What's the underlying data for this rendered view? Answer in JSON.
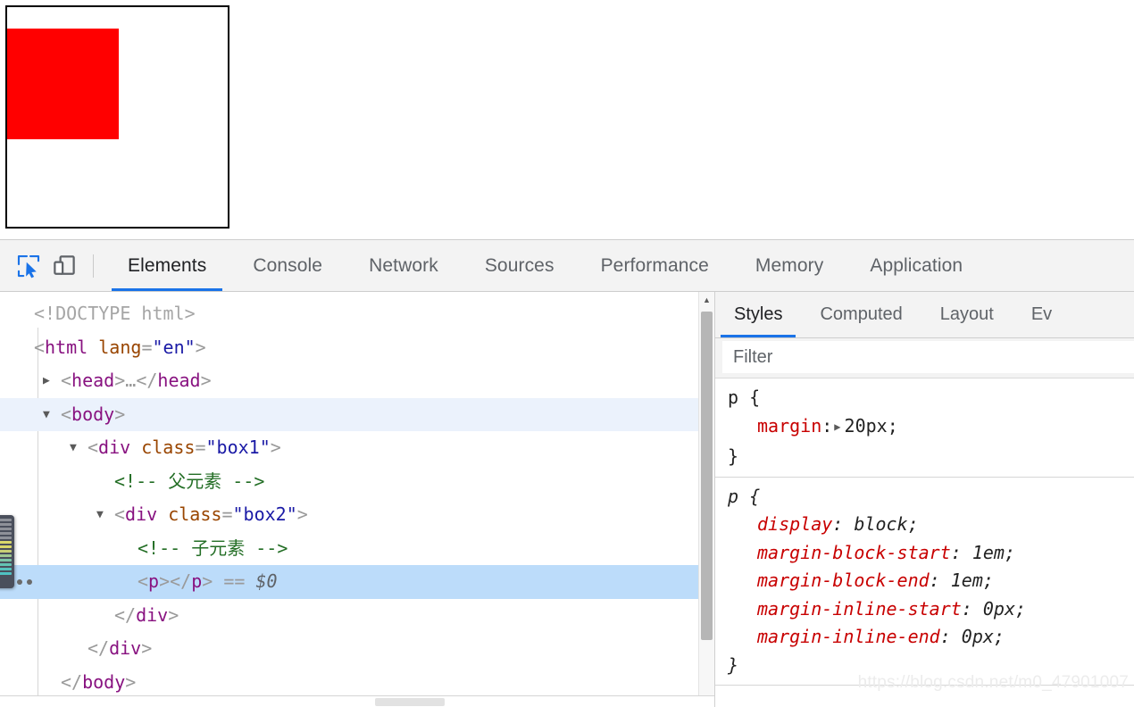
{
  "page": {
    "box1_class": "box1",
    "box2_class": "box2",
    "box2_color": "#ff0000",
    "box1_border_color": "#000000"
  },
  "toolbar": {
    "inspect_icon": "inspect-cursor-icon",
    "device_icon": "device-toolbar-icon",
    "accent_color": "#1a73e8",
    "tabs": [
      {
        "label": "Elements",
        "selected": true
      },
      {
        "label": "Console",
        "selected": false
      },
      {
        "label": "Network",
        "selected": false
      },
      {
        "label": "Sources",
        "selected": false
      },
      {
        "label": "Performance",
        "selected": false
      },
      {
        "label": "Memory",
        "selected": false
      },
      {
        "label": "Application",
        "selected": false
      }
    ]
  },
  "dom_tree": {
    "rows": [
      {
        "indent": 1,
        "twisty": "none",
        "state": "normal",
        "badge": false,
        "tokens": [
          {
            "t": "doctype",
            "v": "<!DOCTYPE html>"
          }
        ]
      },
      {
        "indent": 1,
        "twisty": "none",
        "state": "normal",
        "badge": false,
        "tokens": [
          {
            "t": "bracket",
            "v": "<"
          },
          {
            "t": "tag",
            "v": "html"
          },
          {
            "t": "plain",
            "v": " "
          },
          {
            "t": "attr",
            "v": "lang"
          },
          {
            "t": "eq",
            "v": "="
          },
          {
            "t": "val",
            "v": "\"en\""
          },
          {
            "t": "bracket",
            "v": ">"
          }
        ]
      },
      {
        "indent": 2,
        "twisty": "closed",
        "state": "normal",
        "badge": false,
        "tokens": [
          {
            "t": "bracket",
            "v": "<"
          },
          {
            "t": "tag",
            "v": "head"
          },
          {
            "t": "bracket",
            "v": ">"
          },
          {
            "t": "bracket",
            "v": "…"
          },
          {
            "t": "bracket",
            "v": "</"
          },
          {
            "t": "tag",
            "v": "head"
          },
          {
            "t": "bracket",
            "v": ">"
          }
        ]
      },
      {
        "indent": 2,
        "twisty": "open",
        "state": "hovered",
        "badge": false,
        "tokens": [
          {
            "t": "bracket",
            "v": "<"
          },
          {
            "t": "tag",
            "v": "body"
          },
          {
            "t": "bracket",
            "v": ">"
          }
        ]
      },
      {
        "indent": 3,
        "twisty": "open",
        "state": "normal",
        "badge": false,
        "tokens": [
          {
            "t": "bracket",
            "v": "<"
          },
          {
            "t": "tag",
            "v": "div"
          },
          {
            "t": "plain",
            "v": " "
          },
          {
            "t": "attr",
            "v": "class"
          },
          {
            "t": "eq",
            "v": "="
          },
          {
            "t": "val",
            "v": "\"box1\""
          },
          {
            "t": "bracket",
            "v": ">"
          }
        ]
      },
      {
        "indent": 4,
        "twisty": "none",
        "state": "normal",
        "badge": false,
        "tokens": [
          {
            "t": "comment",
            "v": "<!-- 父元素 -->"
          }
        ]
      },
      {
        "indent": 4,
        "twisty": "open",
        "state": "normal",
        "badge": false,
        "tokens": [
          {
            "t": "bracket",
            "v": "<"
          },
          {
            "t": "tag",
            "v": "div"
          },
          {
            "t": "plain",
            "v": " "
          },
          {
            "t": "attr",
            "v": "class"
          },
          {
            "t": "eq",
            "v": "="
          },
          {
            "t": "val",
            "v": "\"box2\""
          },
          {
            "t": "bracket",
            "v": ">"
          }
        ]
      },
      {
        "indent": 5,
        "twisty": "none",
        "state": "normal",
        "badge": false,
        "tokens": [
          {
            "t": "comment",
            "v": "<!-- 子元素 -->"
          }
        ]
      },
      {
        "indent": 5,
        "twisty": "none",
        "state": "selected",
        "badge": true,
        "tokens": [
          {
            "t": "bracket",
            "v": "<"
          },
          {
            "t": "tag",
            "v": "p"
          },
          {
            "t": "bracket",
            "v": "></"
          },
          {
            "t": "tag",
            "v": "p"
          },
          {
            "t": "bracket",
            "v": ">"
          },
          {
            "t": "plain",
            "v": " "
          },
          {
            "t": "eq",
            "v": "=="
          },
          {
            "t": "plain",
            "v": " "
          },
          {
            "t": "dollar",
            "v": "$0"
          }
        ]
      },
      {
        "indent": 4,
        "twisty": "none",
        "state": "normal",
        "badge": false,
        "tokens": [
          {
            "t": "bracket",
            "v": "</"
          },
          {
            "t": "tag",
            "v": "div"
          },
          {
            "t": "bracket",
            "v": ">"
          }
        ]
      },
      {
        "indent": 3,
        "twisty": "none",
        "state": "normal",
        "badge": false,
        "tokens": [
          {
            "t": "bracket",
            "v": "</"
          },
          {
            "t": "tag",
            "v": "div"
          },
          {
            "t": "bracket",
            "v": ">"
          }
        ]
      },
      {
        "indent": 2,
        "twisty": "none",
        "state": "normal",
        "badge": false,
        "tokens": [
          {
            "t": "bracket",
            "v": "</"
          },
          {
            "t": "tag",
            "v": "body"
          },
          {
            "t": "bracket",
            "v": ">"
          }
        ]
      }
    ]
  },
  "sidebar": {
    "tabs": [
      {
        "label": "Styles",
        "selected": true
      },
      {
        "label": "Computed",
        "selected": false
      },
      {
        "label": "Layout",
        "selected": false
      },
      {
        "label": "Ev",
        "selected": false
      }
    ],
    "filter": {
      "placeholder": "Filter",
      "value": ""
    },
    "rules": [
      {
        "selector": "p {",
        "close": "}",
        "ua": false,
        "declarations": [
          {
            "property": "margin",
            "expander": "▶",
            "value": "20px;"
          }
        ]
      },
      {
        "selector": "p {",
        "close": "}",
        "ua": true,
        "declarations": [
          {
            "property": "display",
            "expander": "",
            "value": "block;"
          },
          {
            "property": "margin-block-start",
            "expander": "",
            "value": "1em;"
          },
          {
            "property": "margin-block-end",
            "expander": "",
            "value": "1em;"
          },
          {
            "property": "margin-inline-start",
            "expander": "",
            "value": "0px;"
          },
          {
            "property": "margin-inline-end",
            "expander": "",
            "value": "0px;"
          }
        ]
      }
    ]
  },
  "watermark": {
    "text": "https://blog.csdn.net/m0_47901007"
  },
  "scrollbars": {
    "up_arrow": "▲",
    "down_arrow": "▼"
  }
}
